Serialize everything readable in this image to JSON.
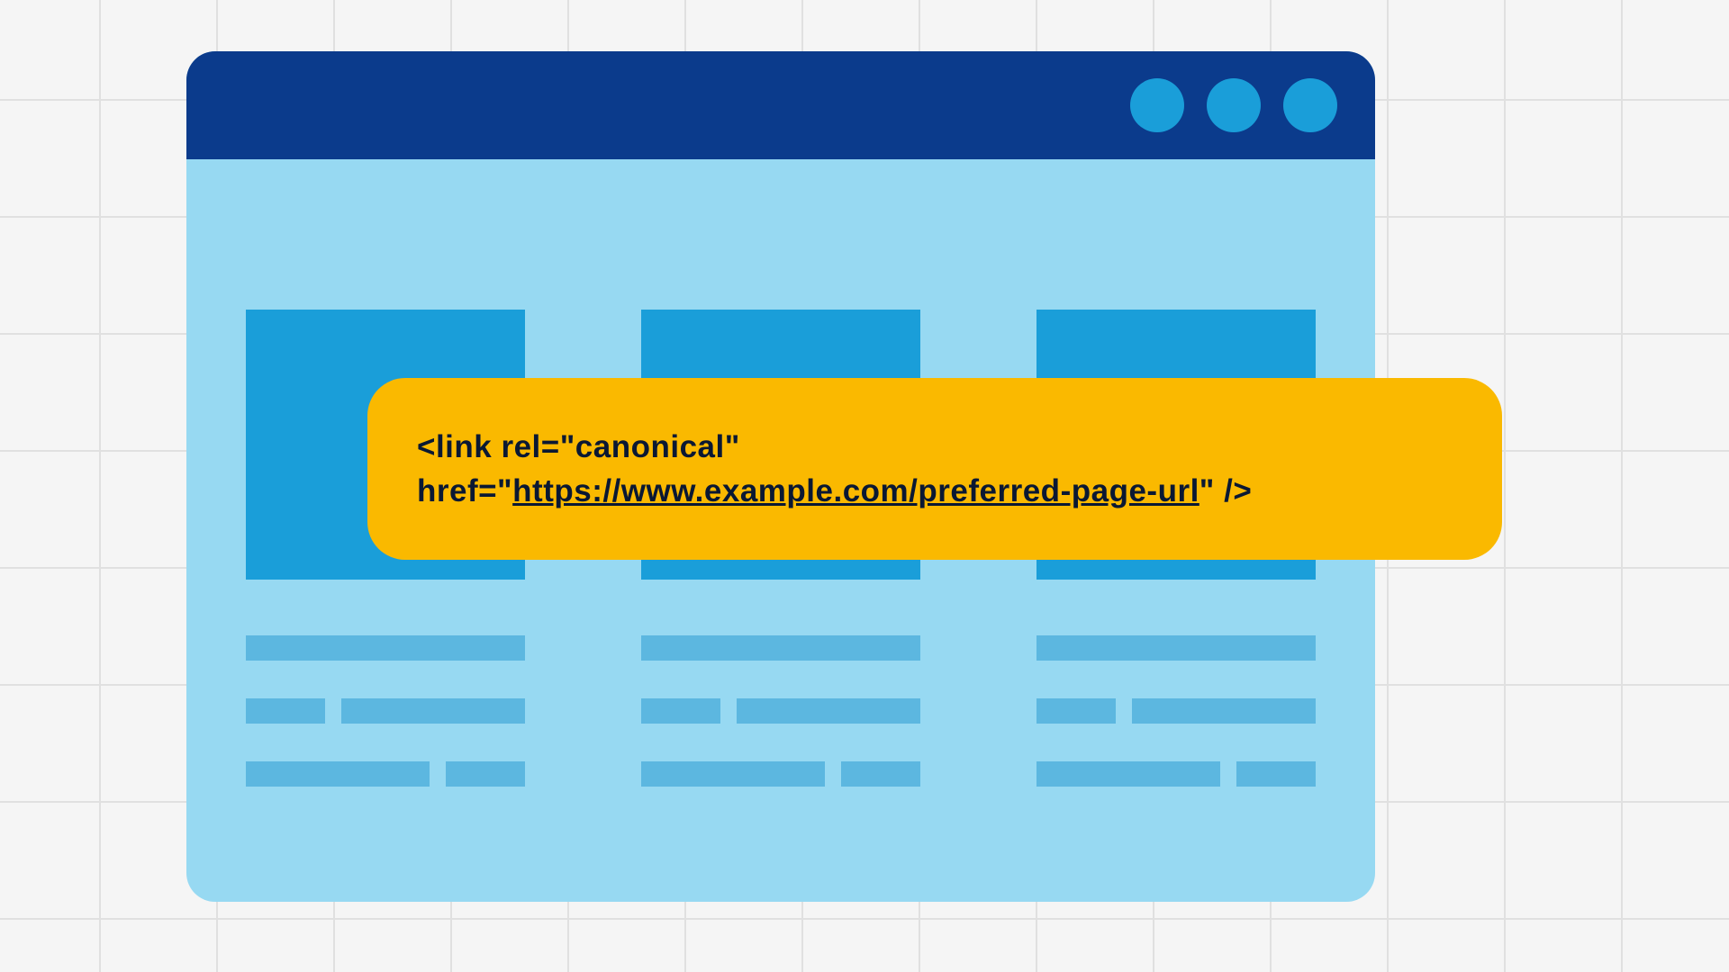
{
  "code_snippet": {
    "prefix": "<link rel=\"canonical\"",
    "href_label": "href=\"",
    "url": "https://www.example.com/preferred-page-url",
    "suffix": "\" />"
  }
}
